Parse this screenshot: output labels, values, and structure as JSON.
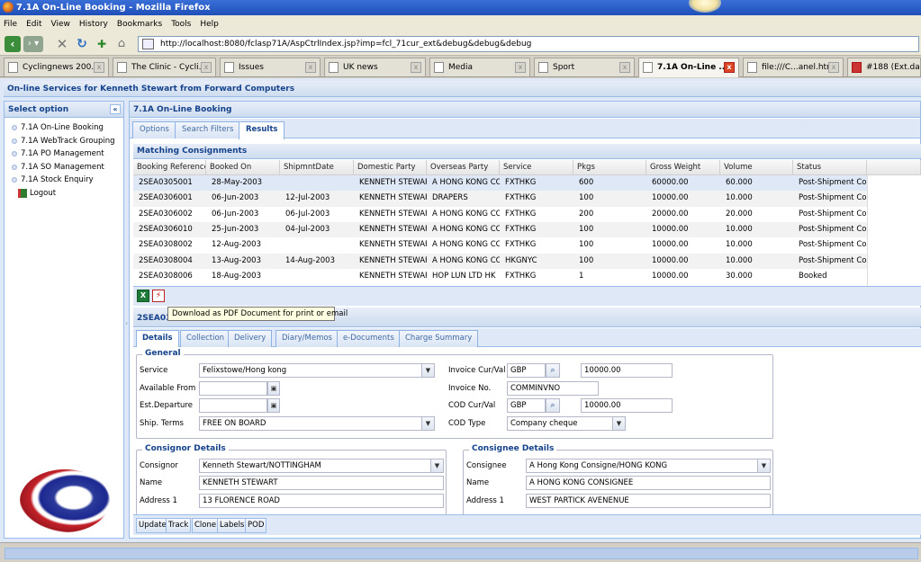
{
  "window": {
    "title": "7.1A On-Line Booking - Mozilla Firefox"
  },
  "menu": [
    "File",
    "Edit",
    "View",
    "History",
    "Bookmarks",
    "Tools",
    "Help"
  ],
  "nav": {
    "url": "http://localhost:8080/fclasp71A/AspCtrlIndex.jsp?imp=fcl_71cur_ext&debug&debug&debug"
  },
  "browser_tabs": [
    {
      "label": "Cyclingnews 200..."
    },
    {
      "label": "The Clinic - Cycli..."
    },
    {
      "label": "Issues"
    },
    {
      "label": "UK news"
    },
    {
      "label": "Media"
    },
    {
      "label": "Sport"
    },
    {
      "label": "7.1A On-Line ..."
    },
    {
      "label": "file:///C...anel.html"
    },
    {
      "label": "#188 (Ext.data."
    }
  ],
  "app": {
    "header": "On-line Services for Kenneth Stewart from Forward Computers"
  },
  "sidebar": {
    "title": "Select option",
    "items": [
      "7.1A On-Line Booking",
      "7.1A WebTrack Grouping",
      "7.1A PO Management",
      "7.1A SO Management",
      "7.1A Stock Enquiry",
      "Logout"
    ]
  },
  "main": {
    "title": "7.1A On-Line Booking",
    "tabs": [
      "Options",
      "Search Filters",
      "Results"
    ]
  },
  "grid": {
    "title": "Matching Consignments",
    "columns": [
      "Booking Reference",
      "Booked On",
      "ShipmntDate",
      "Domestic Party",
      "Overseas Party",
      "Service",
      "Pkgs",
      "Gross Weight",
      "Volume",
      "Status"
    ],
    "rows": [
      [
        "2SEA0305001",
        "28-May-2003",
        "",
        "KENNETH STEWART",
        "A HONG KONG CON",
        "FXTHKG",
        "600",
        "60000.00",
        "60.000",
        "Post-Shipment Conf"
      ],
      [
        "2SEA0306001",
        "06-Jun-2003",
        "12-Jul-2003",
        "KENNETH STEWART",
        "DRAPERS",
        "FXTHKG",
        "100",
        "10000.00",
        "10.000",
        "Post-Shipment Conf"
      ],
      [
        "2SEA0306002",
        "06-Jun-2003",
        "06-Jul-2003",
        "KENNETH STEWART",
        "A HONG KONG CON",
        "FXTHKG",
        "200",
        "20000.00",
        "20.000",
        "Post-Shipment Conf"
      ],
      [
        "2SEA0306010",
        "25-Jun-2003",
        "04-Jul-2003",
        "KENNETH STEWART",
        "A HONG KONG CON",
        "FXTHKG",
        "100",
        "10000.00",
        "10.000",
        "Post-Shipment Conf"
      ],
      [
        "2SEA0308002",
        "12-Aug-2003",
        "",
        "KENNETH STEWART",
        "A HONG KONG CON",
        "FXTHKG",
        "100",
        "10000.00",
        "10.000",
        "Post-Shipment Conf"
      ],
      [
        "2SEA0308004",
        "13-Aug-2003",
        "14-Aug-2003",
        "KENNETH STEWART",
        "A HONG KONG CON",
        "HKGNYC",
        "100",
        "10000.00",
        "10.000",
        "Post-Shipment Conf"
      ],
      [
        "2SEA0308006",
        "18-Aug-2003",
        "",
        "KENNETH STEWART",
        "HOP LUN LTD HK",
        "FXTHKG",
        "1",
        "10000.00",
        "30.000",
        "Booked"
      ]
    ]
  },
  "tooltip": "Download as PDF Document for print or email",
  "detail": {
    "title": "2SEA03",
    "tabs": [
      "Details",
      "Collection",
      "Delivery",
      "Diary/Memos",
      "e-Documents",
      "Charge Summary"
    ],
    "general": {
      "legend": "General",
      "service_label": "Service",
      "service_value": "Felixstowe/Hong kong",
      "available_label": "Available From",
      "est_label": "Est.Departure",
      "terms_label": "Ship. Terms",
      "terms_value": "FREE ON BOARD",
      "inv_cur_label": "Invoice Cur/Val",
      "inv_cur": "GBP",
      "inv_val": "10000.00",
      "inv_no_label": "Invoice No.",
      "inv_no": "COMMINVNO",
      "cod_cur_label": "COD Cur/Val",
      "cod_cur": "GBP",
      "cod_val": "10000.00",
      "cod_type_label": "COD Type",
      "cod_type": "Company cheque"
    },
    "consignor": {
      "legend": "Consignor Details",
      "consignor_label": "Consignor",
      "consignor": "Kenneth Stewart/NOTTINGHAM",
      "name_label": "Name",
      "name": "KENNETH STEWART",
      "addr_label": "Address 1",
      "addr": "13 FLORENCE ROAD"
    },
    "consignee": {
      "legend": "Consignee Details",
      "consignee_label": "Consignee",
      "consignee": "A Hong Kong Consigne/HONG KONG",
      "name_label": "Name",
      "name": "A HONG KONG CONSIGNEE",
      "addr_label": "Address 1",
      "addr": "WEST PARTICK AVENENUE"
    }
  },
  "actions": [
    "Update",
    "Track",
    "Clone",
    "Labels",
    "POD"
  ]
}
